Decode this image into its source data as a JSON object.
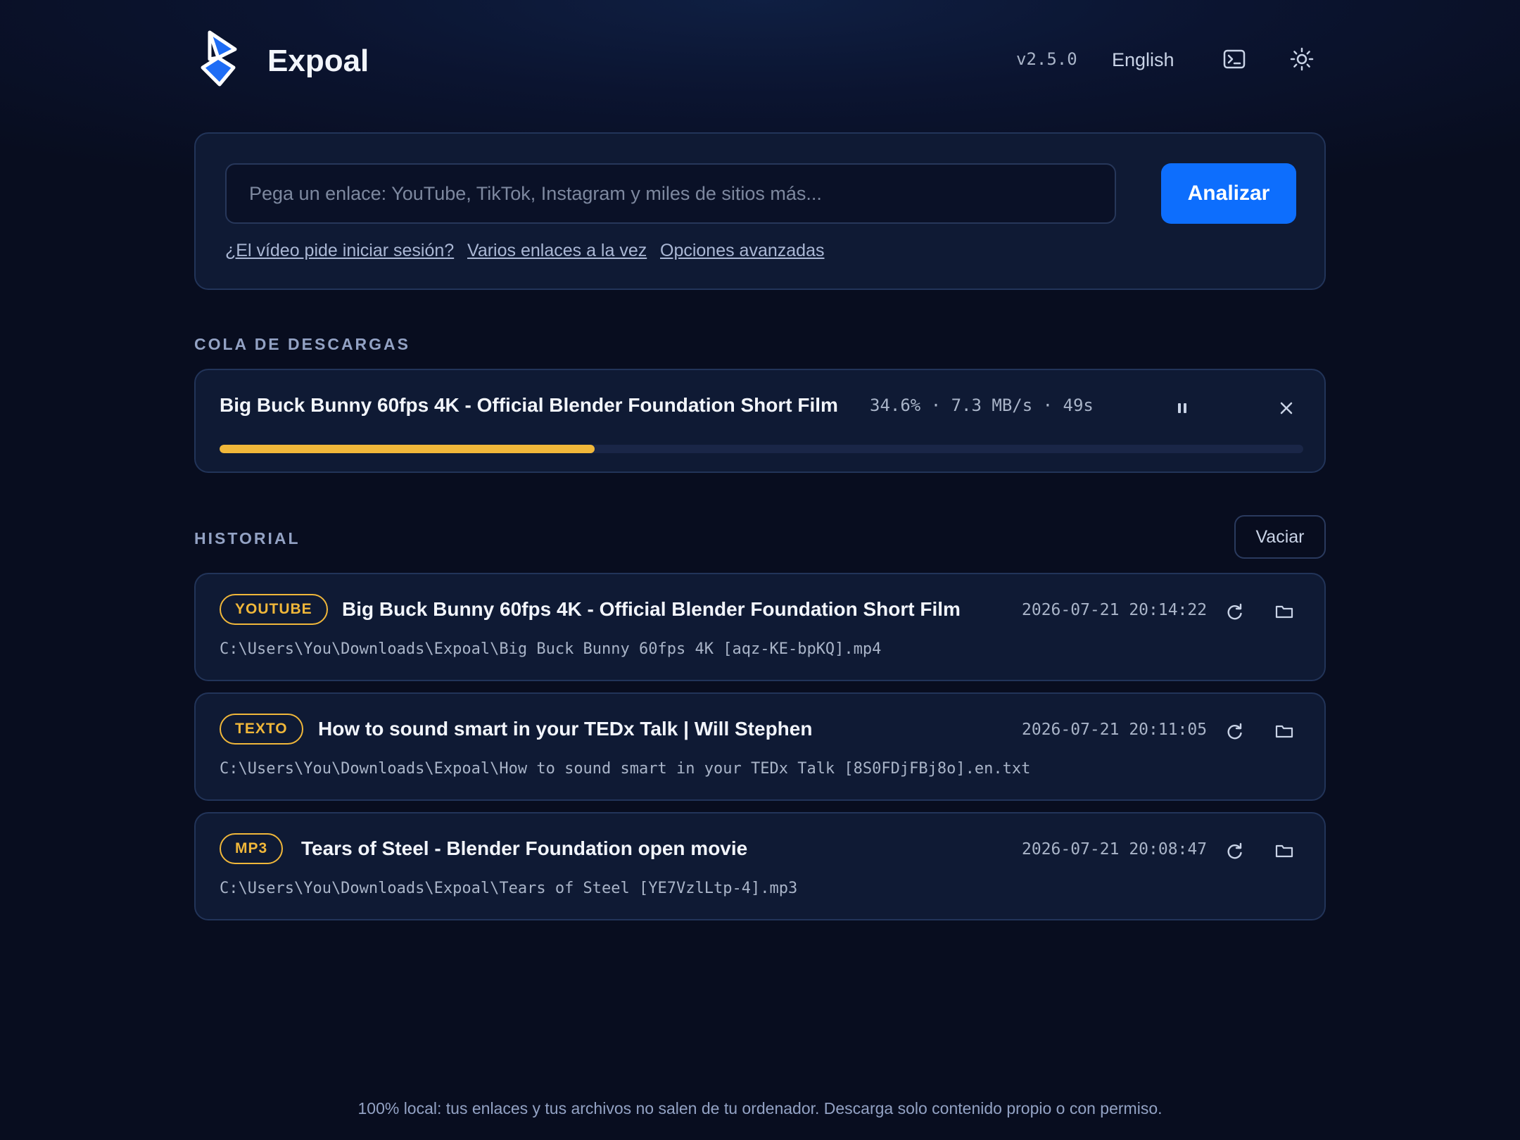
{
  "app": {
    "name": "Expoal",
    "version": "v2.5.0",
    "language": "English"
  },
  "header": {
    "terminal_icon": "terminal-icon",
    "theme_icon": "sun-icon"
  },
  "search": {
    "placeholder": "Pega un enlace: YouTube, TikTok, Instagram y miles de sitios más...",
    "value": "",
    "button_label": "Analizar",
    "links": [
      "¿El vídeo pide iniciar sesión?",
      "Varios enlaces a la vez",
      "Opciones avanzadas"
    ]
  },
  "queue": {
    "section_title": "COLA DE DESCARGAS",
    "items": [
      {
        "title": "Big Buck Bunny 60fps 4K - Official Blender Foundation Short Film",
        "stats": "34.6% · 7.3 MB/s · 49s",
        "progress": 34.6
      }
    ]
  },
  "history": {
    "section_title": "HISTORIAL",
    "clear_label": "Vaciar",
    "items": [
      {
        "badge": "YOUTUBE",
        "title": "Big Buck Bunny 60fps 4K - Official Blender Foundation Short Film",
        "date": "2026-07-21 20:14:22",
        "path": "C:\\Users\\You\\Downloads\\Expoal\\Big Buck Bunny 60fps 4K [aqz-KE-bpKQ].mp4"
      },
      {
        "badge": "TEXTO",
        "title": "How to sound smart in your TEDx Talk | Will Stephen",
        "date": "2026-07-21 20:11:05",
        "path": "C:\\Users\\You\\Downloads\\Expoal\\How to sound smart in your TEDx Talk [8S0FDjFBj8o].en.txt"
      },
      {
        "badge": "MP3",
        "title": "Tears of Steel - Blender Foundation open movie",
        "date": "2026-07-21 20:08:47",
        "path": "C:\\Users\\You\\Downloads\\Expoal\\Tears of Steel [YE7VzlLtp-4].mp3"
      }
    ]
  },
  "footer": {
    "text": "100% local: tus enlaces y tus archivos no salen de tu ordenador. Descarga solo contenido propio o con permiso."
  },
  "colors": {
    "accent": "#0d6efd",
    "badge": "#f0b73a",
    "progress": "#f0b73a",
    "background": "#080d1f",
    "card": "#0f1a34"
  }
}
